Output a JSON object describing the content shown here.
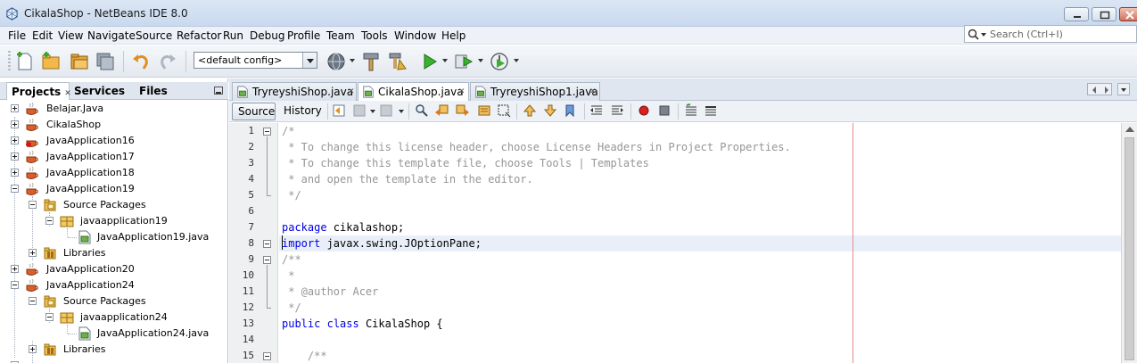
{
  "window": {
    "title": "CikalaShop - NetBeans IDE 8.0"
  },
  "menu": [
    "File",
    "Edit",
    "View",
    "Navigate",
    "Source",
    "Refactor",
    "Run",
    "Debug",
    "Profile",
    "Team",
    "Tools",
    "Window",
    "Help"
  ],
  "search": {
    "placeholder": "Search (Ctrl+I)"
  },
  "toolbar": {
    "config": "<default config>"
  },
  "left_panel": {
    "tabs": [
      "Projects",
      "Services",
      "Files"
    ],
    "tree": [
      {
        "label": "Belajar.Java"
      },
      {
        "label": "CikalaShop"
      },
      {
        "label": "JavaApplication16"
      },
      {
        "label": "JavaApplication17"
      },
      {
        "label": "JavaApplication18"
      },
      {
        "label": "JavaApplication19"
      },
      {
        "label": "Source Packages"
      },
      {
        "label": "javaapplication19"
      },
      {
        "label": "JavaApplication19.java"
      },
      {
        "label": "Libraries"
      },
      {
        "label": "JavaApplication20"
      },
      {
        "label": "JavaApplication24"
      },
      {
        "label": "Source Packages"
      },
      {
        "label": "javaapplication24"
      },
      {
        "label": "JavaApplication24.java"
      },
      {
        "label": "Libraries"
      }
    ]
  },
  "editor": {
    "tabs": [
      "TryreyshiShop.java",
      "CikalaShop.java",
      "TryreyshiShop1.java"
    ],
    "source_label": "Source",
    "history_label": "History",
    "lines": [
      {
        "num": "1",
        "parts": [
          {
            "t": "/*",
            "c": "cm"
          }
        ]
      },
      {
        "num": "2",
        "parts": [
          {
            "t": " * To change this license header, choose License Headers in Project Properties.",
            "c": "cm"
          }
        ]
      },
      {
        "num": "3",
        "parts": [
          {
            "t": " * To change this template file, choose Tools | Templates",
            "c": "cm"
          }
        ]
      },
      {
        "num": "4",
        "parts": [
          {
            "t": " * and open the template in the editor.",
            "c": "cm"
          }
        ]
      },
      {
        "num": "5",
        "parts": [
          {
            "t": " */",
            "c": "cm"
          }
        ]
      },
      {
        "num": "6",
        "parts": []
      },
      {
        "num": "7",
        "parts": [
          {
            "t": "package",
            "c": "kw"
          },
          {
            "t": " cikalashop;",
            "c": ""
          }
        ]
      },
      {
        "num": "8",
        "parts": [
          {
            "t": "import",
            "c": "kw"
          },
          {
            "t": " javax.swing.JOptionPane;",
            "c": ""
          }
        ]
      },
      {
        "num": "9",
        "parts": [
          {
            "t": "/**",
            "c": "cm"
          }
        ]
      },
      {
        "num": "10",
        "parts": [
          {
            "t": " *",
            "c": "cm"
          }
        ]
      },
      {
        "num": "11",
        "parts": [
          {
            "t": " * @author Acer",
            "c": "cm"
          }
        ]
      },
      {
        "num": "12",
        "parts": [
          {
            "t": " */",
            "c": "cm"
          }
        ]
      },
      {
        "num": "13",
        "parts": [
          {
            "t": "public",
            "c": "kw"
          },
          {
            "t": " ",
            "c": ""
          },
          {
            "t": "class",
            "c": "kw"
          },
          {
            "t": " CikalaShop {",
            "c": ""
          }
        ]
      },
      {
        "num": "14",
        "parts": []
      },
      {
        "num": "15",
        "parts": [
          {
            "t": "    /**",
            "c": "cm"
          }
        ]
      }
    ]
  }
}
